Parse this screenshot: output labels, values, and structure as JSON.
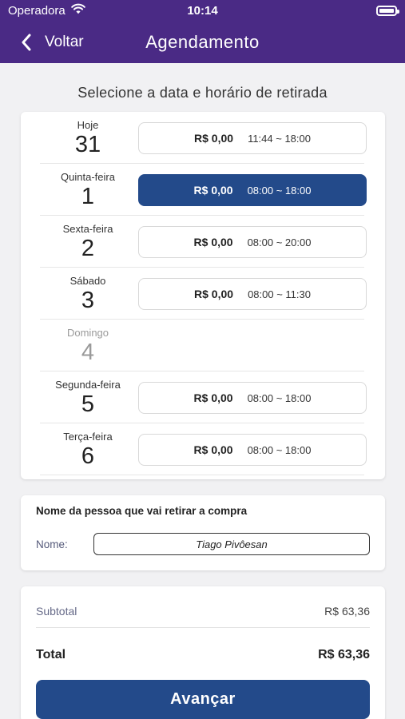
{
  "status_bar": {
    "carrier": "Operadora",
    "time": "10:14",
    "wifi_icon": "wifi-icon",
    "battery_icon": "battery-icon"
  },
  "nav": {
    "back_label": "Voltar",
    "back_icon": "chevron-left-icon",
    "title": "Agendamento"
  },
  "colors": {
    "header": "#4a2a85",
    "accent": "#234a8a"
  },
  "schedule": {
    "heading": "Selecione a data e horário de retirada",
    "days": [
      {
        "name": "Hoje",
        "number": "31",
        "available": true,
        "selected": false,
        "price": "R$ 0,00",
        "hours": "11:44 ~ 18:00"
      },
      {
        "name": "Quinta-feira",
        "number": "1",
        "available": true,
        "selected": true,
        "price": "R$ 0,00",
        "hours": "08:00 ~ 18:00"
      },
      {
        "name": "Sexta-feira",
        "number": "2",
        "available": true,
        "selected": false,
        "price": "R$ 0,00",
        "hours": "08:00 ~ 20:00"
      },
      {
        "name": "Sábado",
        "number": "3",
        "available": true,
        "selected": false,
        "price": "R$ 0,00",
        "hours": "08:00 ~ 11:30"
      },
      {
        "name": "Domingo",
        "number": "4",
        "available": false,
        "selected": false,
        "price": "",
        "hours": ""
      },
      {
        "name": "Segunda-feira",
        "number": "5",
        "available": true,
        "selected": false,
        "price": "R$ 0,00",
        "hours": "08:00 ~ 18:00"
      },
      {
        "name": "Terça-feira",
        "number": "6",
        "available": true,
        "selected": false,
        "price": "R$ 0,00",
        "hours": "08:00 ~ 18:00"
      }
    ]
  },
  "pickup": {
    "heading": "Nome da pessoa que vai retirar a compra",
    "label": "Nome:",
    "value": "Tiago Pivôesan"
  },
  "summary": {
    "subtotal_label": "Subtotal",
    "subtotal_value": "R$ 63,36",
    "total_label": "Total",
    "total_value": "R$ 63,36",
    "advance_label": "Avançar"
  }
}
